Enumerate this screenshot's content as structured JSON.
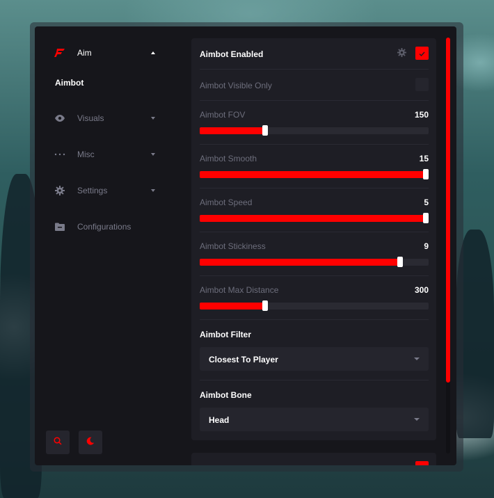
{
  "sidebar": {
    "items": [
      {
        "label": "Aim",
        "expanded": true,
        "icon": "brand-logo-icon"
      },
      {
        "label": "Visuals",
        "expanded": false,
        "icon": "eye-icon"
      },
      {
        "label": "Misc",
        "expanded": false,
        "icon": "ellipsis-icon"
      },
      {
        "label": "Settings",
        "expanded": false,
        "icon": "gear-icon"
      },
      {
        "label": "Configurations",
        "icon": "folder-icon"
      }
    ],
    "sub_items": [
      {
        "label": "Aimbot"
      }
    ],
    "bottom_buttons": [
      {
        "icon": "search-icon"
      },
      {
        "icon": "moon-icon"
      }
    ]
  },
  "settings": {
    "aimbot_enabled": {
      "label": "Aimbot Enabled",
      "checked": true
    },
    "visible_only": {
      "label": "Aimbot Visible Only",
      "checked": false
    },
    "fov": {
      "label": "Aimbot FOV",
      "value": "150",
      "fraction": 0.285
    },
    "smooth": {
      "label": "Aimbot Smooth",
      "value": "15",
      "fraction": 1.0
    },
    "speed": {
      "label": "Aimbot Speed",
      "value": "5",
      "fraction": 1.0
    },
    "stickiness": {
      "label": "Aimbot Stickiness",
      "value": "9",
      "fraction": 0.875
    },
    "max_distance": {
      "label": "Aimbot Max Distance",
      "value": "300",
      "fraction": 0.285
    },
    "filter": {
      "label": "Aimbot Filter",
      "selected": "Closest To Player"
    },
    "bone": {
      "label": "Aimbot Bone",
      "selected": "Head"
    }
  },
  "colors": {
    "accent": "#ff0000",
    "panel": "#16161b",
    "card": "#1e1e25",
    "muted_text": "#6d6e7c"
  }
}
